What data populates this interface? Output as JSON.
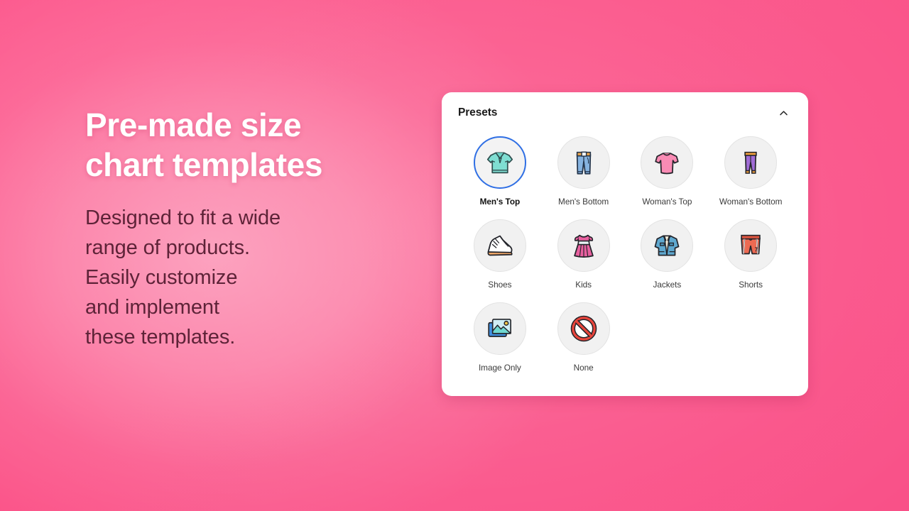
{
  "hero": {
    "headline": "Pre-made size\nchart templates",
    "subcopy": "Designed to fit a wide\nrange of products.\nEasily customize\nand implement\nthese templates.",
    "headline_color": "#ffffff",
    "subcopy_color": "#5e2338",
    "background_color": "#fb4f89"
  },
  "card": {
    "title": "Presets",
    "collapse_icon": "chevron-up-icon",
    "selected_preset": "Men's Top",
    "selection_color": "#2f6fe4",
    "presets": [
      {
        "label": "Men's Top",
        "icon": "polo-shirt-icon",
        "selected": true
      },
      {
        "label": "Men's Bottom",
        "icon": "jeans-icon",
        "selected": false
      },
      {
        "label": "Woman's Top",
        "icon": "womens-tee-icon",
        "selected": false
      },
      {
        "label": "Woman's Bottom",
        "icon": "leggings-icon",
        "selected": false
      },
      {
        "label": "Shoes",
        "icon": "sneaker-icon",
        "selected": false
      },
      {
        "label": "Kids",
        "icon": "dress-icon",
        "selected": false
      },
      {
        "label": "Jackets",
        "icon": "denim-jacket-icon",
        "selected": false
      },
      {
        "label": "Shorts",
        "icon": "shorts-icon",
        "selected": false
      },
      {
        "label": "Image Only",
        "icon": "image-icon",
        "selected": false
      },
      {
        "label": "None",
        "icon": "no-entry-icon",
        "selected": false
      }
    ]
  }
}
